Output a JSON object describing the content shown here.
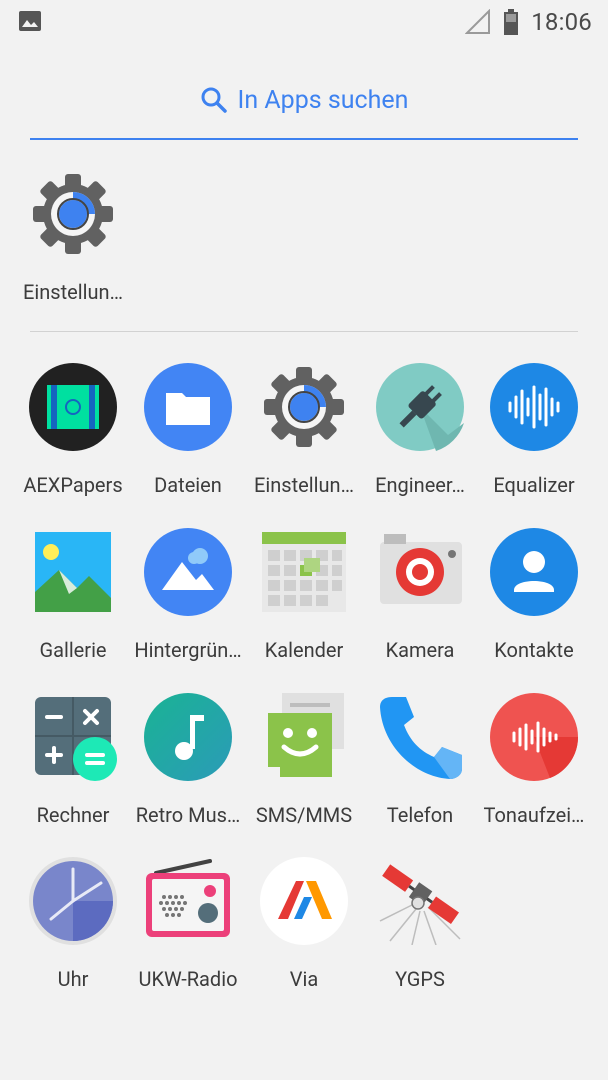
{
  "status_bar": {
    "time": "18:06",
    "left_icon": "image-icon",
    "signal_icon": "signal-icon",
    "battery_icon": "battery-icon"
  },
  "search": {
    "placeholder": "In Apps suchen",
    "icon": "search-icon"
  },
  "suggested": [
    {
      "label": "Einstellun…",
      "icon": "settings-gear-icon"
    }
  ],
  "apps": [
    {
      "label": "AEXPapers",
      "icon": "aexpapers-icon"
    },
    {
      "label": "Dateien",
      "icon": "files-folder-icon"
    },
    {
      "label": "Einstellun…",
      "icon": "settings-gear-icon"
    },
    {
      "label": "Engineer…",
      "icon": "plug-icon"
    },
    {
      "label": "Equalizer",
      "icon": "equalizer-waveform-icon"
    },
    {
      "label": "Gallerie",
      "icon": "gallery-picture-icon"
    },
    {
      "label": "Hintergrün…",
      "icon": "wallpaper-icon"
    },
    {
      "label": "Kalender",
      "icon": "calendar-icon"
    },
    {
      "label": "Kamera",
      "icon": "camera-icon"
    },
    {
      "label": "Kontakte",
      "icon": "contacts-person-icon"
    },
    {
      "label": "Rechner",
      "icon": "calculator-icon"
    },
    {
      "label": "Retro Mus…",
      "icon": "music-note-icon"
    },
    {
      "label": "SMS/MMS",
      "icon": "sms-chat-icon"
    },
    {
      "label": "Telefon",
      "icon": "phone-icon"
    },
    {
      "label": "Tonaufzei…",
      "icon": "sound-recorder-icon"
    },
    {
      "label": "Uhr",
      "icon": "clock-icon"
    },
    {
      "label": "UKW-Radio",
      "icon": "fm-radio-icon"
    },
    {
      "label": "Via",
      "icon": "via-browser-icon"
    },
    {
      "label": "YGPS",
      "icon": "satellite-icon"
    }
  ],
  "colors": {
    "accent": "#3e82f0",
    "background": "#f2f2f2"
  }
}
